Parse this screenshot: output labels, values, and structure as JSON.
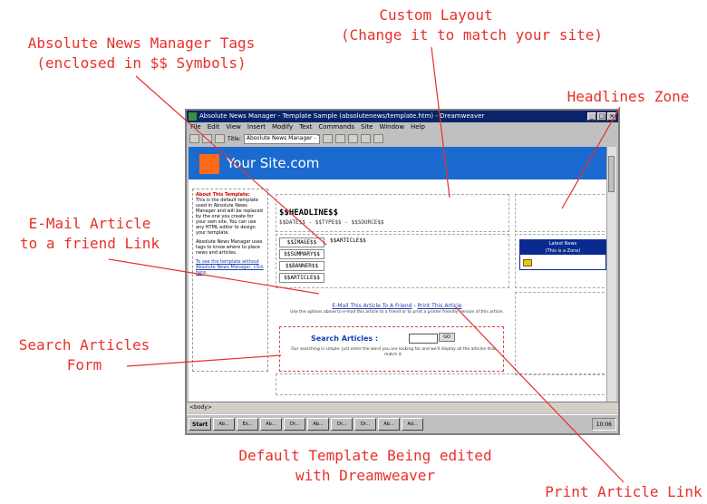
{
  "callouts": {
    "custom_layout_1": "Custom Layout",
    "custom_layout_2": "(Change it to match your site)",
    "tags_1": "Absolute News Manager Tags",
    "tags_2": "(enclosed in $$ Symbols)",
    "headlines_zone": "Headlines Zone",
    "email_1": "E-Mail Article",
    "email_2": "to a friend Link",
    "search_1": "Search Articles",
    "search_2": "Form",
    "default_1": "Default Template Being edited",
    "default_2": "with Dreamweaver",
    "print_link": "Print Article Link"
  },
  "window": {
    "title": "Absolute News Manager - Template Sample (absolutenews/template.htm) - Dreamweaver",
    "menus": [
      "File",
      "Edit",
      "View",
      "Insert",
      "Modify",
      "Text",
      "Commands",
      "Site",
      "Window",
      "Help"
    ],
    "title_field": "Absolute News Manager - Template",
    "status": "<body>"
  },
  "site": {
    "name": "Your Site.com",
    "headline_tag": "$$HEADLINE$$",
    "headline_sub": "$$DATE$$ - $$TYPE$$ - $$SOURCE$$",
    "tags": [
      "$$IMAGE$$",
      "$$SUMMARY$$",
      "$$BANNER$$",
      "$$ARTICLE$$"
    ],
    "article_tag": "$$ARTICLE$$",
    "email_link": "E-Mail This Article To A Friend",
    "separator": " - ",
    "print_link": "Print This Article",
    "notice": "Use the options above to e-mail this article to a friend or to print a printer friendly version of this article.",
    "search_label": "Search Articles :",
    "search_go": "GO",
    "search_help": "Our searching is simple: just enter the word you are looking for and we'll display all the articles that match it.",
    "latest_title": "Latest News",
    "latest_sub": "(This is a Zone)",
    "left_heading": "About This Template:",
    "left_text": "This is the default template used in Absolute News Manager and will be replaced by the one you create for your own site. You can use any HTML editor to design your template.",
    "left_text2": "Absolute News Manager uses tags to know where to place news and articles.",
    "left_link": "To see the template without Absolute News Manager, click here."
  },
  "taskbar": {
    "start": "Start",
    "tasks": [
      "Ab...",
      "Ex...",
      "Ab...",
      "Dr...",
      "Ab...",
      "Dr...",
      "Dr...",
      "Ab...",
      "Ad..."
    ],
    "clock": "10:06"
  },
  "colors": {
    "callout": "#e8302a",
    "site_header": "#1b6ad0",
    "logo": "#ff6a1a"
  }
}
